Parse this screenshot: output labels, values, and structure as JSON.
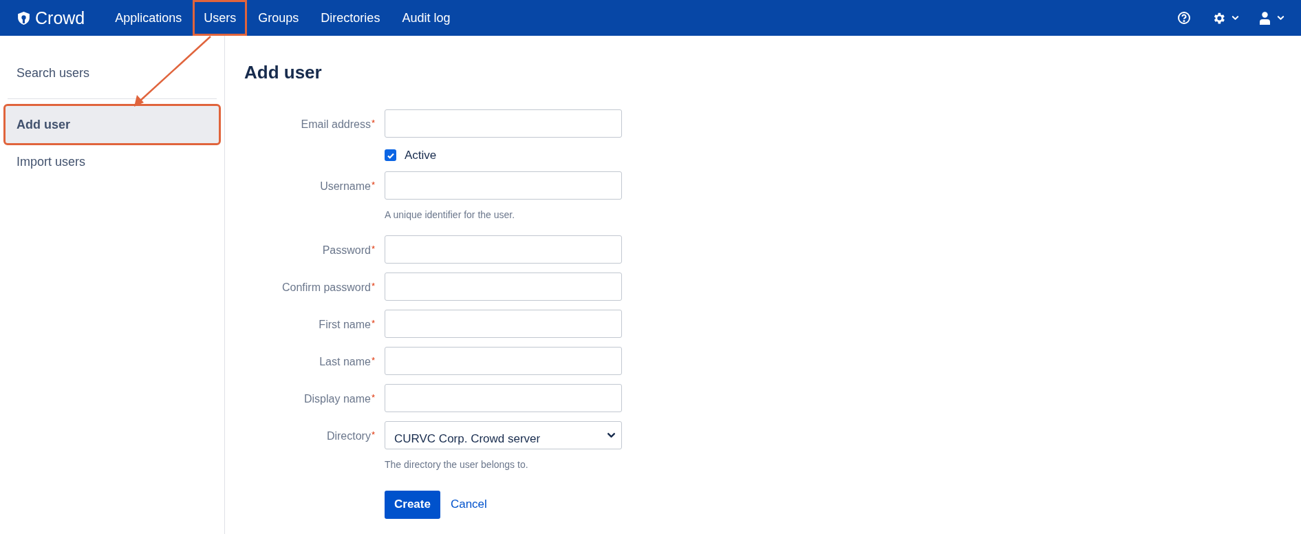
{
  "header": {
    "logo": "Crowd",
    "nav": [
      {
        "label": "Applications",
        "highlighted": false
      },
      {
        "label": "Users",
        "highlighted": true
      },
      {
        "label": "Groups",
        "highlighted": false
      },
      {
        "label": "Directories",
        "highlighted": false
      },
      {
        "label": "Audit log",
        "highlighted": false
      }
    ]
  },
  "sidebar": {
    "items": [
      {
        "label": "Search users",
        "selected": false,
        "highlighted": false,
        "divider_after": true
      },
      {
        "label": "Add user",
        "selected": true,
        "highlighted": true,
        "divider_after": false
      },
      {
        "label": "Import users",
        "selected": false,
        "highlighted": false,
        "divider_after": false
      }
    ]
  },
  "page": {
    "title": "Add user"
  },
  "form": {
    "rows": [
      {
        "kind": "text",
        "label": "Email address",
        "required_mark": "*"
      },
      {
        "kind": "checkbox",
        "label": "Active",
        "checked": true
      },
      {
        "kind": "text",
        "label": "Username",
        "required_mark": "*",
        "hint": "A unique identifier for the user."
      },
      {
        "kind": "password",
        "label": "Password",
        "required_mark": "*"
      },
      {
        "kind": "password",
        "label": "Confirm password",
        "required_mark": "*"
      },
      {
        "kind": "text",
        "label": "First name",
        "required_mark": "*"
      },
      {
        "kind": "text",
        "label": "Last name",
        "required_mark": "*"
      },
      {
        "kind": "text",
        "label": "Display name",
        "required_mark": "*"
      },
      {
        "kind": "select",
        "label": "Directory",
        "required_mark": "*",
        "value": "CURVC Corp. Crowd server",
        "hint": "The directory the user belongs to."
      }
    ],
    "buttons": {
      "primary": "Create",
      "secondary": "Cancel"
    }
  },
  "annotation": {
    "arrow": true
  }
}
